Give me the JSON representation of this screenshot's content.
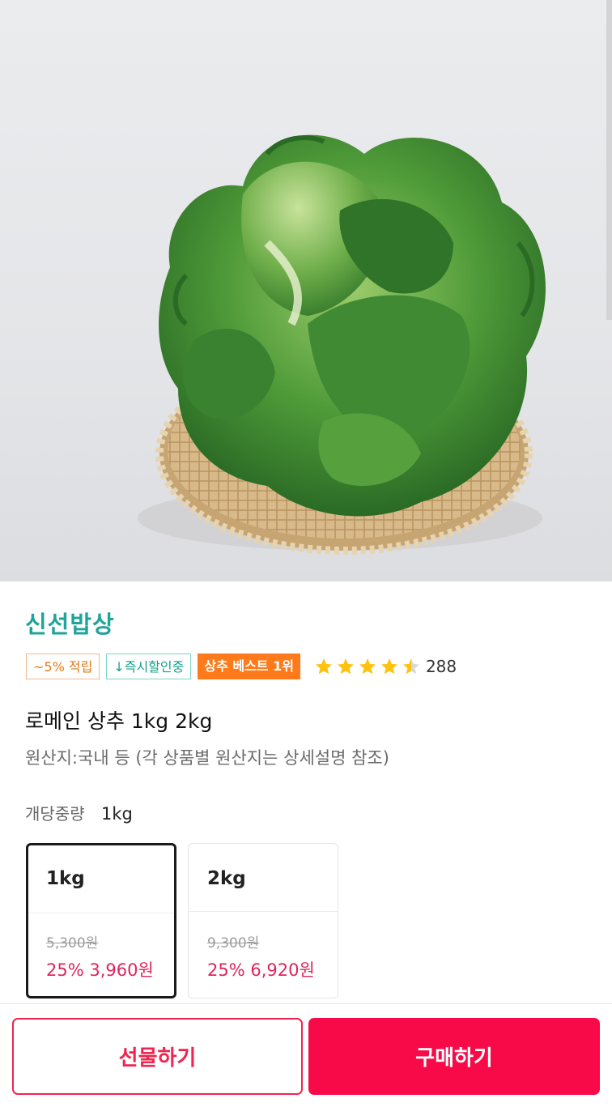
{
  "seller": {
    "name": "신선밥상"
  },
  "badges": {
    "points": "~5% 적립",
    "discount": "↓즉시할인중",
    "best": "상추 베스트 1위"
  },
  "rating": {
    "stars": 4.5,
    "count": "288",
    "star_color": "#ffc20e"
  },
  "product": {
    "title": "로메인 상추 1kg 2kg",
    "origin": "원산지:국내 등 (각 상품별 원산지는 상세설명 참조)",
    "weight_label": "개당중량",
    "weight_value": "1kg"
  },
  "options": [
    {
      "name": "1kg",
      "original_price": "5,300원",
      "sale_price": "25% 3,960원",
      "selected": true
    },
    {
      "name": "2kg",
      "original_price": "9,300원",
      "sale_price": "25% 6,920원",
      "selected": false
    }
  ],
  "actions": {
    "gift_label": "선물하기",
    "buy_label": "구매하기"
  },
  "colors": {
    "accent": "#f70a47",
    "seller": "#20a39a",
    "best_badge": "#ff7a1a"
  },
  "image": {
    "subject": "lettuce-on-bamboo-basket"
  }
}
